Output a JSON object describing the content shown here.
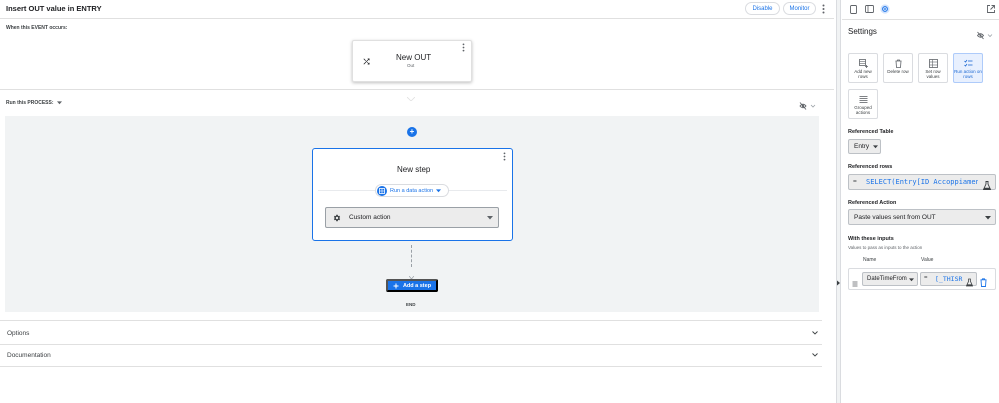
{
  "header": {
    "title": "Insert OUT value in ENTRY",
    "disable_label": "Disable",
    "monitor_label": "Monitor"
  },
  "event": {
    "label": "When this EVENT occurs:",
    "title": "New OUT",
    "subtitle": "Out"
  },
  "process": {
    "label": "Run this PROCESS:",
    "step_title": "New step",
    "action_chip": "Run a data action",
    "custom_action": "Custom action",
    "add_step_label": "Add a step",
    "end_label": "END"
  },
  "accordions": [
    {
      "label": "Options"
    },
    {
      "label": "Documentation"
    }
  ],
  "settings": {
    "title": "Settings",
    "actions": [
      {
        "label": "Add new rows",
        "icon": "add-rows-icon",
        "selected": false
      },
      {
        "label": "Delete row",
        "icon": "delete-row-icon",
        "selected": false
      },
      {
        "label": "Set row values",
        "icon": "set-row-values-icon",
        "selected": false
      },
      {
        "label": "Run action on rows",
        "icon": "run-action-icon",
        "selected": true
      },
      {
        "label": "Grouped actions",
        "icon": "grouped-actions-icon",
        "selected": false
      }
    ],
    "referenced_table_label": "Referenced Table",
    "referenced_table_value": "Entry",
    "referenced_rows_label": "Referenced rows",
    "referenced_rows_eq": "=",
    "referenced_rows_expr": "SELECT(Entry[ID Accoppiamento",
    "referenced_action_label": "Referenced Action",
    "referenced_action_value": "Paste values sent from OUT",
    "inputs_label": "With these inputs",
    "inputs_help": "Values to pass as inputs to the action",
    "col_name": "Name",
    "col_value": "Value",
    "input_row": {
      "name": "DateTimeFrom",
      "eq": "=",
      "expr": "[_THISR"
    }
  },
  "colors": {
    "accent": "#1a73e8",
    "canvas": "#f1f3f4",
    "selected_tile": "#e8f0fe"
  }
}
